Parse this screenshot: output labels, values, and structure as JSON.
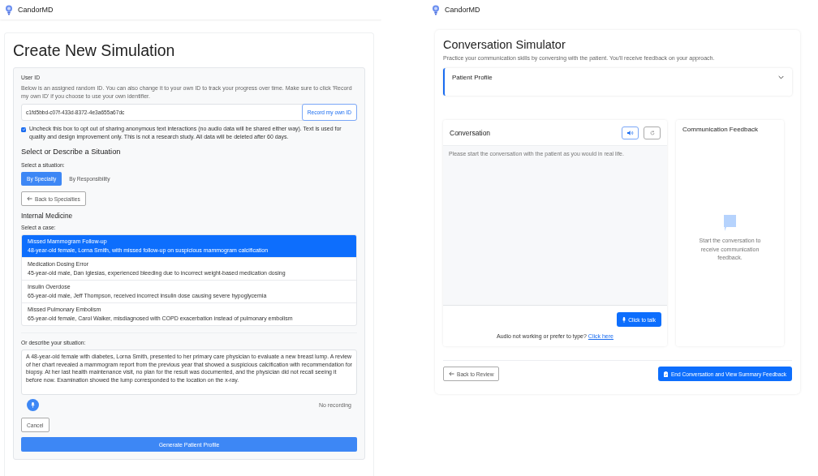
{
  "left": {
    "brand": "CandorMD",
    "title": "Create New Simulation",
    "user_id": {
      "label": "User ID",
      "description": "Below is an assigned random ID. You can also change it to your own ID to track your progress over time. Make sure to click 'Record my own ID' if you choose to use your own identifier.",
      "value": "c1fd5bbd-c07f-433d-8372-4e3a655a67dc",
      "record_button": "Record my own ID"
    },
    "consent": {
      "checked": true,
      "text": "Uncheck this box to opt out of sharing anonymous text interactions (no audio data will be shared either way). Text is used for quality and design improvement only. This is not a research study. All data will be deleted after 60 days."
    },
    "section_heading": "Select or Describe a Situation",
    "situation_label": "Select a situation:",
    "tabs": [
      {
        "label": "By Specialty",
        "selected": true
      },
      {
        "label": "By Responsibility",
        "selected": false
      }
    ],
    "back_button": "Back to Specialties",
    "specialty": "Internal Medicine",
    "case_label": "Select a case:",
    "cases": [
      {
        "title": "Missed Mammogram Follow-up",
        "description": "48-year-old female, Lorna Smith, with missed follow-up on suspicious mammogram calcification",
        "selected": true
      },
      {
        "title": "Medication Dosing Error",
        "description": "45-year-old male, Dan Iglesias, experienced bleeding due to incorrect weight-based medication dosing",
        "selected": false
      },
      {
        "title": "Insulin Overdose",
        "description": "65-year-old male, Jeff Thompson, received incorrect insulin dose causing severe hypoglycemia",
        "selected": false
      },
      {
        "title": "Missed Pulmonary Embolism",
        "description": "65-year-old female, Carol Walker, misdiagnosed with COPD exacerbation instead of pulmonary embolism",
        "selected": false
      }
    ],
    "describe_label": "Or describe your situation:",
    "describe_value": "A 48-year-old female with diabetes, Lorna Smith, presented to her primary care physician to evaluate a new breast lump. A review of her chart revealed a mammogram report from the previous year that showed a suspicious calcification with recommendation for biopsy. At her last health maintenance visit, no plan for the result was documented, and the physician did not recall seeing it before now. Examination showed the lump corresponded to the location on the x-ray.",
    "recording_status": "No recording",
    "cancel_button": "Cancel",
    "generate_button": "Generate Patient Profile"
  },
  "right": {
    "brand": "CandorMD",
    "title": "Conversation Simulator",
    "subtitle": "Practice your communication skills by conversing with the patient. You'll receive feedback on your approach.",
    "patient_profile": {
      "label": "Patient Profile",
      "expanded": false
    },
    "conversation": {
      "title": "Conversation",
      "sound_on": true,
      "placeholder": "Please start the conversation with the patient as you would in real life.",
      "talk_button": "Click to talk",
      "fallback_text": "Audio not working or prefer to type?",
      "fallback_link": "Click here"
    },
    "feedback": {
      "title": "Communication Feedback",
      "empty_text": "Start the conversation to receive communication feedback."
    },
    "back_button": "Back to Review",
    "end_button": "End Conversation and View Summary Feedback"
  }
}
